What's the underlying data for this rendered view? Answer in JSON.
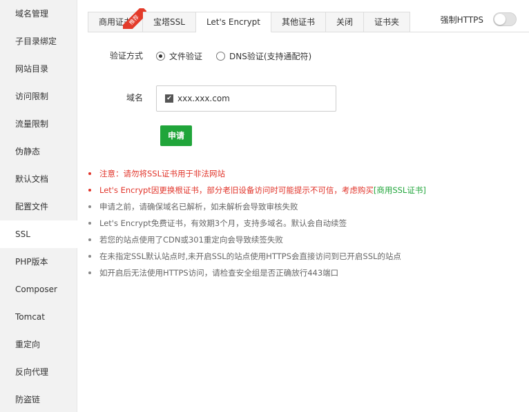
{
  "sidebar": {
    "items": [
      {
        "label": "域名管理"
      },
      {
        "label": "子目录绑定"
      },
      {
        "label": "网站目录"
      },
      {
        "label": "访问限制"
      },
      {
        "label": "流量限制"
      },
      {
        "label": "伪静态"
      },
      {
        "label": "默认文档"
      },
      {
        "label": "配置文件"
      },
      {
        "label": "SSL",
        "active": true
      },
      {
        "label": "PHP版本"
      },
      {
        "label": "Composer"
      },
      {
        "label": "Tomcat"
      },
      {
        "label": "重定向"
      },
      {
        "label": "反向代理"
      },
      {
        "label": "防盗链"
      }
    ]
  },
  "tabs": [
    {
      "label": "商用证书",
      "badge": "推荐"
    },
    {
      "label": "宝塔SSL"
    },
    {
      "label": "Let's Encrypt",
      "active": true
    },
    {
      "label": "其他证书"
    },
    {
      "label": "关闭"
    },
    {
      "label": "证书夹"
    }
  ],
  "force_https": {
    "label": "强制HTTPS",
    "enabled": false
  },
  "form": {
    "verify_label": "验证方式",
    "options": [
      {
        "label": "文件验证",
        "checked": true
      },
      {
        "label": "DNS验证(支持通配符)",
        "checked": false
      }
    ],
    "domain_label": "域名",
    "domain_value": "xxx.xxx.com",
    "domain_checked": true,
    "apply_label": "申请"
  },
  "notes": {
    "n1": "注意：请勿将SSL证书用于非法网站",
    "n2_text": "Let's Encrypt因更换根证书，部分老旧设备访问时可能提示不可信，考虑购买",
    "n2_link": "[商用SSL证书]",
    "n3": "申请之前，请确保域名已解析，如未解析会导致审核失败",
    "n4": "Let's Encrypt免费证书，有效期3个月，支持多域名。默认会自动续签",
    "n5": "若您的站点使用了CDN或301重定向会导致续签失败",
    "n6": "在未指定SSL默认站点时,未开启SSL的站点使用HTTPS会直接访问到已开启SSL的站点",
    "n7": "如开启后无法使用HTTPS访问，请检查安全组是否正确放行443端口"
  },
  "colors": {
    "accent": "#20a53a",
    "warning": "#e1342a",
    "badge": "#e33b2a"
  }
}
